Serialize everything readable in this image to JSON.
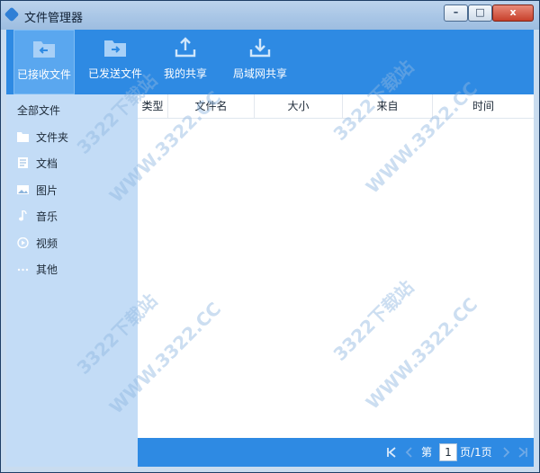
{
  "window": {
    "title": "文件管理器",
    "minimize_label": "–",
    "maximize_label": "□",
    "close_label": "x"
  },
  "toolbar": {
    "items": [
      {
        "label": "已接收文件",
        "icon": "folder-receive-icon",
        "active": true
      },
      {
        "label": "已发送文件",
        "icon": "folder-send-icon",
        "active": false
      },
      {
        "label": "我的共享",
        "icon": "upload-icon",
        "active": false
      },
      {
        "label": "局域网共享",
        "icon": "download-icon",
        "active": false
      }
    ]
  },
  "sidebar": {
    "items": [
      {
        "label": "全部文件",
        "icon": ""
      },
      {
        "label": "文件夹",
        "icon": "folder-icon"
      },
      {
        "label": "文档",
        "icon": "document-icon"
      },
      {
        "label": "图片",
        "icon": "image-icon"
      },
      {
        "label": "音乐",
        "icon": "music-icon"
      },
      {
        "label": "视频",
        "icon": "video-icon"
      },
      {
        "label": "其他",
        "icon": "more-icon"
      }
    ]
  },
  "table": {
    "columns": [
      "类型",
      "文件名",
      "大小",
      "来自",
      "时间"
    ],
    "rows": []
  },
  "pagination": {
    "prefix": "第",
    "current_page": "1",
    "suffix": "页/1页"
  },
  "watermark": {
    "text_cn": "3322下载站",
    "text_url": "WWW.3322.CC"
  },
  "colors": {
    "accent": "#2e8ae3",
    "sidebar": "#c3dcf6",
    "active_tab": "#5aa7ef"
  }
}
